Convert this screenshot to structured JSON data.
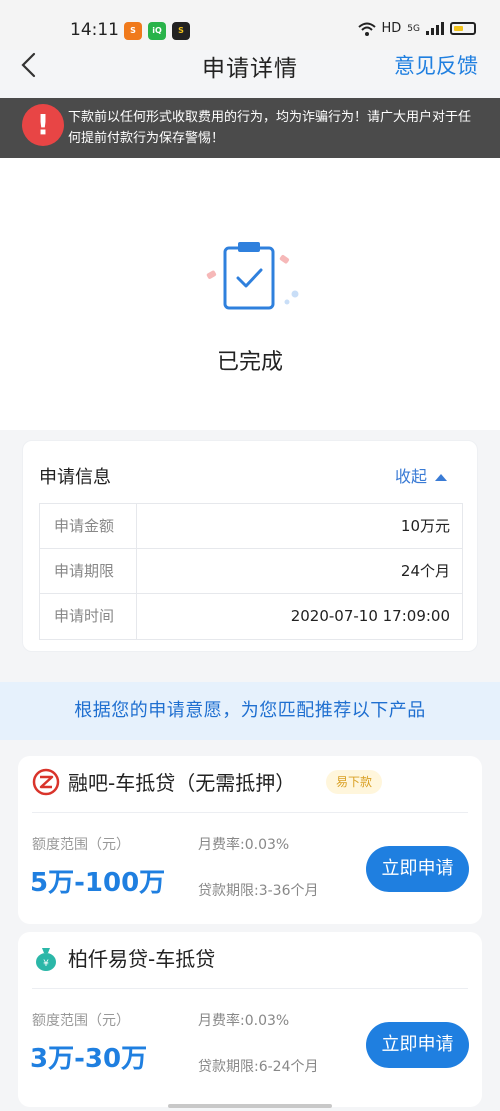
{
  "status_bar": {
    "time": "14:11",
    "network": "HD",
    "signal_type": "5G"
  },
  "nav": {
    "title": "申请详情",
    "feedback_label": "意见反馈"
  },
  "warning": {
    "line1": "下款前以任何形式收取费用的行为，均为诈骗行为！请广大用户对于任",
    "line2": "何提前付款行为保存警惕！"
  },
  "status": {
    "label": "已完成"
  },
  "info": {
    "title": "申请信息",
    "collapse_label": "收起",
    "rows": [
      {
        "key": "申请金额",
        "value": "10万元"
      },
      {
        "key": "申请期限",
        "value": "24个月"
      },
      {
        "key": "申请时间",
        "value": "2020-07-10 17:09:00"
      }
    ]
  },
  "recommend": {
    "banner": "根据您的申请意愿，为您匹配推荐以下产品"
  },
  "products": [
    {
      "name": "融吧-车抵贷（无需抵押）",
      "tag": "易下款",
      "range_label": "额度范围（元）",
      "range": "5万-100万",
      "rate": "月费率:0.03%",
      "term": "贷款期限:3-36个月",
      "apply_label": "立即申请"
    },
    {
      "name": "柏仟易贷-车抵贷",
      "tag": "",
      "range_label": "额度范围（元）",
      "range": "3万-30万",
      "rate": "月费率:0.03%",
      "term": "贷款期限:6-24个月",
      "apply_label": "立即申请"
    }
  ],
  "colors": {
    "accent": "#1f7fe0",
    "warning_bg": "#4b4b4b",
    "warning_icon": "#e84545"
  }
}
